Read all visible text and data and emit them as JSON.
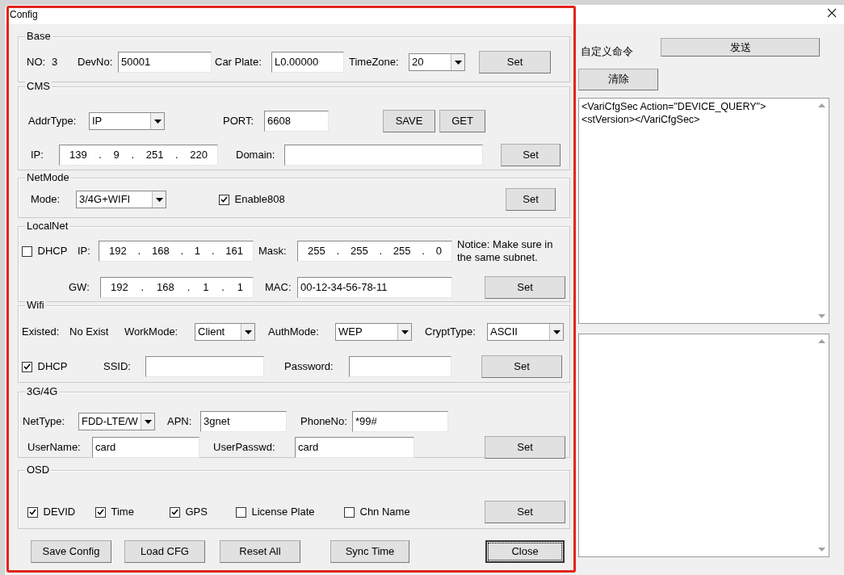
{
  "window": {
    "title": "Config"
  },
  "groups": [
    {
      "title": "Base",
      "rows": [
        {
          "items": [
            {
              "kind": "label",
              "text": "NO:"
            },
            {
              "kind": "text",
              "text": "3"
            },
            {
              "kind": "label",
              "text": "DevNo:"
            },
            {
              "kind": "input",
              "value": "50001"
            },
            {
              "kind": "label",
              "text": "Car Plate:"
            },
            {
              "kind": "input",
              "value": "L0.00000"
            },
            {
              "kind": "label",
              "text": "TimeZone:"
            },
            {
              "kind": "select",
              "value": "20"
            },
            {
              "kind": "button",
              "label": "Set"
            }
          ]
        }
      ]
    },
    {
      "title": "CMS",
      "rows": [
        {
          "items": [
            {
              "kind": "label",
              "text": "AddrType:"
            },
            {
              "kind": "select",
              "value": "IP"
            },
            {
              "kind": "label",
              "text": "PORT:"
            },
            {
              "kind": "input",
              "value": "6608"
            },
            {
              "kind": "button",
              "label": "SAVE"
            },
            {
              "kind": "button",
              "label": "GET"
            }
          ]
        },
        {
          "items": [
            {
              "kind": "label",
              "text": "IP:"
            },
            {
              "kind": "ip",
              "octets": [
                "139",
                "9",
                "251",
                "220"
              ],
              "separator": "."
            },
            {
              "kind": "label",
              "text": "Domain:"
            },
            {
              "kind": "input"
            },
            {
              "kind": "button",
              "label": "Set"
            }
          ]
        }
      ]
    },
    {
      "title": "NetMode",
      "rows": [
        {
          "items": [
            {
              "kind": "label",
              "text": "Mode:"
            },
            {
              "kind": "select",
              "value": "3/4G+WIFI"
            },
            {
              "kind": "checkbox",
              "label": "Enable808",
              "checked": true
            },
            {
              "kind": "button",
              "label": "Set"
            }
          ]
        }
      ]
    },
    {
      "title": "LocalNet",
      "rows": [
        {
          "items": [
            {
              "kind": "checkbox",
              "label": "DHCP",
              "checked": false
            },
            {
              "kind": "label",
              "text": "IP:"
            },
            {
              "kind": "ip",
              "octets": [
                "192",
                "168",
                "1",
                "161"
              ],
              "separator": "."
            },
            {
              "kind": "label",
              "text": "Mask:"
            },
            {
              "kind": "ip",
              "octets": [
                "255",
                "255",
                "255",
                "0"
              ],
              "separator": "."
            },
            {
              "kind": "notice",
              "text": "Notice: Make sure in the same subnet."
            }
          ]
        },
        {
          "items": [
            {
              "kind": "label",
              "text": "GW:"
            },
            {
              "kind": "ip",
              "octets": [
                "192",
                "168",
                "1",
                "1"
              ],
              "separator": "."
            },
            {
              "kind": "label",
              "text": "MAC:"
            },
            {
              "kind": "input",
              "value": "00-12-34-56-78-11"
            },
            {
              "kind": "button",
              "label": "Set"
            }
          ]
        }
      ]
    },
    {
      "title": "Wifi",
      "rows": [
        {
          "items": [
            {
              "kind": "label",
              "text": "Existed:"
            },
            {
              "kind": "text",
              "text": "No Exist"
            },
            {
              "kind": "label",
              "text": "WorkMode:"
            },
            {
              "kind": "select",
              "value": "Client"
            },
            {
              "kind": "label",
              "text": "AuthMode:"
            },
            {
              "kind": "select",
              "value": "WEP"
            },
            {
              "kind": "label",
              "text": "CryptType:"
            },
            {
              "kind": "select",
              "value": "ASCII"
            }
          ]
        },
        {
          "items": [
            {
              "kind": "checkbox",
              "label": "DHCP",
              "checked": true
            },
            {
              "kind": "label",
              "text": "SSID:"
            },
            {
              "kind": "input"
            },
            {
              "kind": "label",
              "text": "Password:"
            },
            {
              "kind": "input"
            },
            {
              "kind": "button",
              "label": "Set"
            }
          ]
        }
      ]
    },
    {
      "title": "3G/4G",
      "rows": [
        {
          "items": [
            {
              "kind": "label",
              "text": "NetType:"
            },
            {
              "kind": "select",
              "value": "FDD-LTE/W"
            },
            {
              "kind": "label",
              "text": "APN:"
            },
            {
              "kind": "input",
              "value": "3gnet"
            },
            {
              "kind": "label",
              "text": "PhoneNo:"
            },
            {
              "kind": "input",
              "value": "*99#"
            }
          ]
        },
        {
          "items": [
            {
              "kind": "label",
              "text": "UserName:"
            },
            {
              "kind": "input",
              "value": "card"
            },
            {
              "kind": "label",
              "text": "UserPasswd:"
            },
            {
              "kind": "input",
              "value": "card"
            },
            {
              "kind": "button",
              "label": "Set"
            }
          ]
        }
      ]
    },
    {
      "title": "OSD",
      "rows": [
        {
          "items": [
            {
              "kind": "checkbox",
              "label": "DEVID",
              "checked": true
            },
            {
              "kind": "checkbox",
              "label": "Time",
              "checked": true
            },
            {
              "kind": "checkbox",
              "label": "GPS",
              "checked": true
            },
            {
              "kind": "checkbox",
              "label": "License Plate",
              "checked": false
            },
            {
              "kind": "checkbox",
              "label": "Chn Name",
              "checked": false
            },
            {
              "kind": "button",
              "label": "Set"
            }
          ]
        }
      ]
    }
  ],
  "footer_buttons": [
    {
      "label": "Save Config",
      "focused": false
    },
    {
      "label": "Load CFG",
      "focused": false
    },
    {
      "label": "Reset All",
      "focused": false
    },
    {
      "label": "Sync Time",
      "focused": false
    },
    {
      "label": "Close",
      "focused": true
    }
  ],
  "custom_command": {
    "label": "自定义命令",
    "send_button": "发送",
    "clear_button": "清除",
    "command_text": "<VariCfgSec Action=\"DEVICE_QUERY\"><stVersion></VariCfgSec>"
  },
  "annotations": [
    {
      "kind": "rectangle",
      "color": "#e3241b"
    }
  ]
}
